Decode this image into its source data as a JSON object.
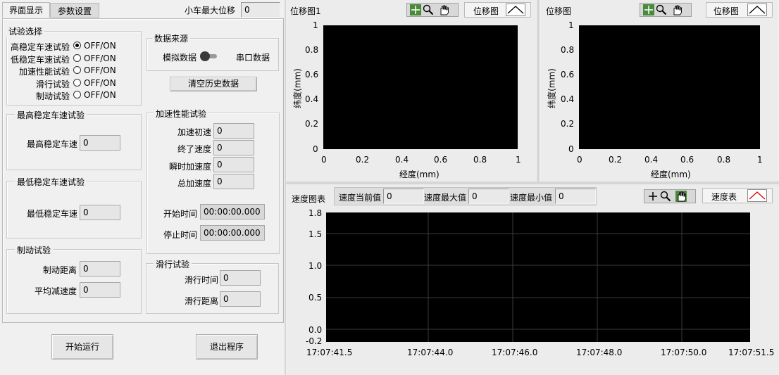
{
  "tabs": [
    {
      "label": "界面显示",
      "active": true
    },
    {
      "label": "参数设置",
      "active": false
    }
  ],
  "max_displacement": {
    "label": "小车最大位移",
    "value": "0"
  },
  "test_select": {
    "title": "试验选择",
    "items": [
      {
        "label": "高稳定车速试验",
        "state": "OFF/ON",
        "selected": true
      },
      {
        "label": "低稳定车速试验",
        "state": "OFF/ON",
        "selected": false
      },
      {
        "label": "加速性能试验",
        "state": "OFF/ON",
        "selected": false
      },
      {
        "label": "滑行试验",
        "state": "OFF/ON",
        "selected": false
      },
      {
        "label": "制动试验",
        "state": "OFF/ON",
        "selected": false
      }
    ]
  },
  "data_source": {
    "title": "数据来源",
    "left": "模拟数据",
    "right": "串口数据"
  },
  "clear_history": "清空历史数据",
  "high_speed": {
    "title": "最高稳定车速试验",
    "label": "最高稳定车速",
    "value": "0"
  },
  "low_speed": {
    "title": "最低稳定车速试验",
    "label": "最低稳定车速",
    "value": "0"
  },
  "accel": {
    "title": "加速性能试验",
    "fields": [
      {
        "label": "加速初速",
        "value": "0"
      },
      {
        "label": "终了速度",
        "value": "0"
      },
      {
        "label": "瞬时加速度",
        "value": "0"
      },
      {
        "label": "总加速度",
        "value": "0"
      }
    ],
    "start_label": "开始时间",
    "start_value": "00:00:00.000",
    "stop_label": "停止时间",
    "stop_value": "00:00:00.000"
  },
  "brake": {
    "title": "制动试验",
    "fields": [
      {
        "label": "制动距离",
        "value": "0"
      },
      {
        "label": "平均减速度",
        "value": "0"
      }
    ]
  },
  "coast": {
    "title": "滑行试验",
    "fields": [
      {
        "label": "滑行时间",
        "value": "0"
      },
      {
        "label": "滑行距离",
        "value": "0"
      }
    ]
  },
  "buttons": {
    "start": "开始运行",
    "exit": "退出程序"
  },
  "displacement_graph_1": {
    "title": "位移图1",
    "legend": "位移图",
    "tools": [
      "crosshair-icon",
      "zoom-icon",
      "hand-icon"
    ]
  },
  "displacement_graph_2": {
    "title": "位移图",
    "legend": "位移图",
    "tools": [
      "crosshair-icon",
      "zoom-icon",
      "hand-icon"
    ]
  },
  "speed_graph": {
    "title": "速度图表",
    "current_label": "速度当前值",
    "current_value": "0",
    "max_label": "速度最大值",
    "max_value": "0",
    "min_label": "速度最小值",
    "min_value": "0",
    "legend": "速度表",
    "tools": [
      "crosshair-icon",
      "zoom-icon",
      "hand-icon"
    ]
  },
  "chart_data": [
    {
      "type": "line",
      "title": "位移图1",
      "xlabel": "经度(mm)",
      "ylabel": "纬度(mm)",
      "xlim": [
        0,
        1
      ],
      "ylim": [
        0,
        1
      ],
      "x_ticks": [
        "0",
        "0.2",
        "0.4",
        "0.6",
        "0.8",
        "1"
      ],
      "y_ticks": [
        "1",
        "0.8",
        "0.6",
        "0.4",
        "0.2",
        "0"
      ],
      "series": [],
      "grid": false
    },
    {
      "type": "line",
      "title": "位移图",
      "xlabel": "经度(mm)",
      "ylabel": "纬度(mm)",
      "xlim": [
        0,
        1
      ],
      "ylim": [
        0,
        1
      ],
      "x_ticks": [
        "0",
        "0.2",
        "0.4",
        "0.6",
        "0.8",
        "1"
      ],
      "y_ticks": [
        "1",
        "0.8",
        "0.6",
        "0.4",
        "0.2",
        "0"
      ],
      "series": [],
      "grid": false
    },
    {
      "type": "line",
      "title": "速度图表",
      "xlabel": "",
      "ylabel": "",
      "ylim": [
        -0.2,
        1.8
      ],
      "x_ticks": [
        "17:07:41.5",
        "17:07:44.0",
        "17:07:46.0",
        "17:07:48.0",
        "17:07:50.0",
        "17:07:51.5"
      ],
      "y_ticks": [
        "1.8",
        "1.5",
        "1.0",
        "0.5",
        "0.0",
        "-0.2"
      ],
      "series": [],
      "grid": true
    }
  ]
}
